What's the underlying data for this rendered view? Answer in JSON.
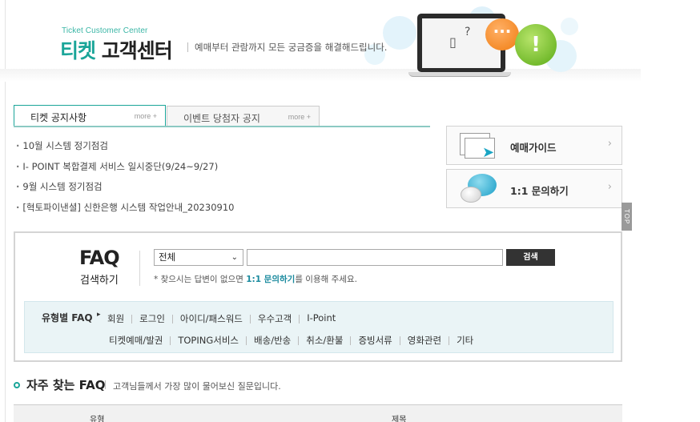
{
  "header": {
    "brand_small": "Ticket Customer Center",
    "brand_main_accent": "티켓",
    "brand_main_rest": "고객센터",
    "description": "예매부터 관람까지 모든 궁금증을 해결해드립니다.",
    "bubble_orange_text": "···",
    "bubble_green_text": "!"
  },
  "notice": {
    "tabs": [
      {
        "label": "티켓 공지사항",
        "more": "more +"
      },
      {
        "label": "이벤트 당첨자 공지",
        "more": "more +"
      }
    ],
    "items": [
      "10월 시스템 정기점검",
      "I- POINT 복합결제 서비스 일시중단(9/24~9/27)",
      "9월 시스템 정기점검",
      "[혁토파이낸셜] 신한은행 시스템 작업안내_20230910"
    ]
  },
  "side": {
    "guide_label": "예매가이드",
    "inquiry_label": "1:1 문의하기",
    "chevron": "›",
    "top_button": "TOP"
  },
  "faq": {
    "title": "FAQ",
    "subtitle": "검색하기",
    "select_value": "전체",
    "search_value": "",
    "search_button": "검색",
    "hint_prefix": "* 찾으시는 답변이 없으면 ",
    "hint_link": "1:1 문의하기",
    "hint_suffix": "를 이용해 주세요.",
    "type_label": "유형별 FAQ",
    "types_row1": [
      "회원",
      "로그인",
      "아이디/패스워드",
      "우수고객",
      "I-Point"
    ],
    "types_row2": [
      "티켓예매/발권",
      "TOPING서비스",
      "배송/반송",
      "취소/환불",
      "증빙서류",
      "영화관련",
      "기타"
    ]
  },
  "frequent": {
    "title": "자주 찾는 FAQ",
    "description": "고객님들께서 가장 많이 물어보신 질문입니다.",
    "columns": [
      "유형",
      "제목"
    ]
  }
}
